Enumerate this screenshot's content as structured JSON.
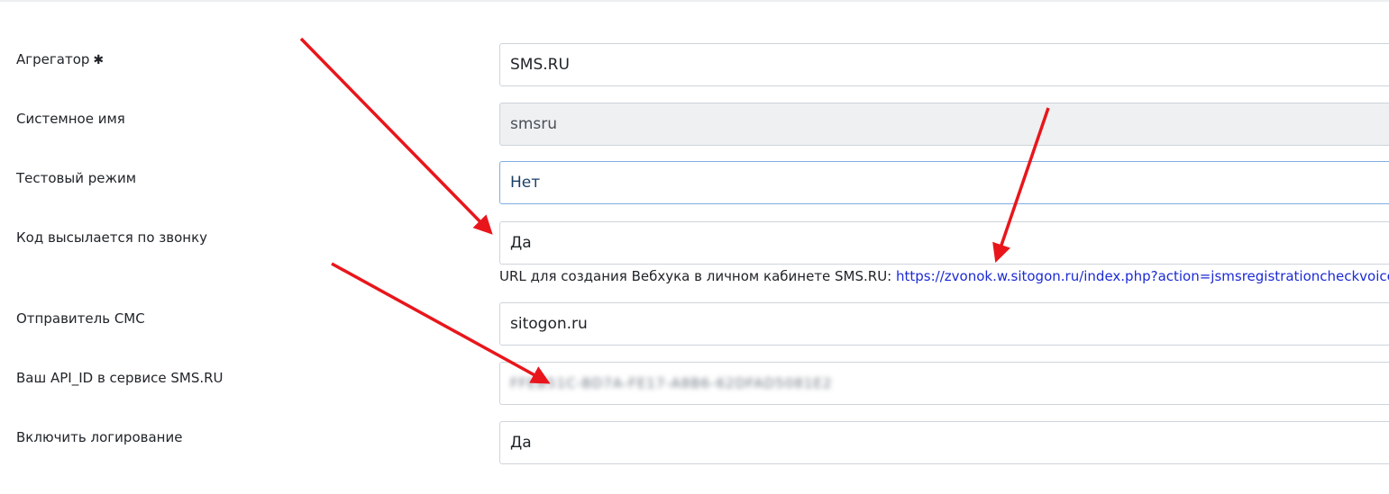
{
  "form": {
    "aggregator": {
      "label": "Агрегатор",
      "required_mark": "✱",
      "value": "SMS.RU"
    },
    "system_name": {
      "label": "Системное имя",
      "value": "smsru"
    },
    "test_mode": {
      "label": "Тестовый режим",
      "value": "Нет"
    },
    "call_code": {
      "label": "Код высылается по звонку",
      "value": "Да",
      "help_text": "URL для создания Вебхука в личном кабинете SMS.RU: ",
      "help_link": "https://zvonok.w.sitogon.ru/index.php?action=jsmsregistrationcheckvoice"
    },
    "sender": {
      "label": "Отправитель СМС",
      "value": "sitogon.ru"
    },
    "api_id": {
      "label": "Ваш API_ID в сервисе SMS.RU",
      "value": "FFEB51C-BD7A-FE17-A8B6-62DFAD5081E2"
    },
    "logging": {
      "label": "Включить логирование",
      "value": "Да"
    }
  },
  "annotations": {
    "arrow_color": "#e8161b"
  }
}
